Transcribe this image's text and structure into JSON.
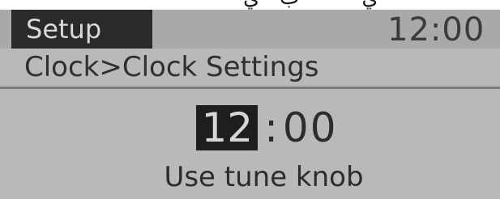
{
  "header": {
    "mode_label": "Setup",
    "time": "12:00"
  },
  "breadcrumb": "Clock>Clock Settings",
  "clock": {
    "hour": "12",
    "separator": ":",
    "minutes": "00"
  },
  "hint": "Use tune knob",
  "colors": {
    "screen_background": "#b9b9b7",
    "header_background": "#a9aaa8",
    "active_tab": "#2a2a2a",
    "selected_field": "#1e1e1e",
    "text": "#2c2c2c"
  }
}
